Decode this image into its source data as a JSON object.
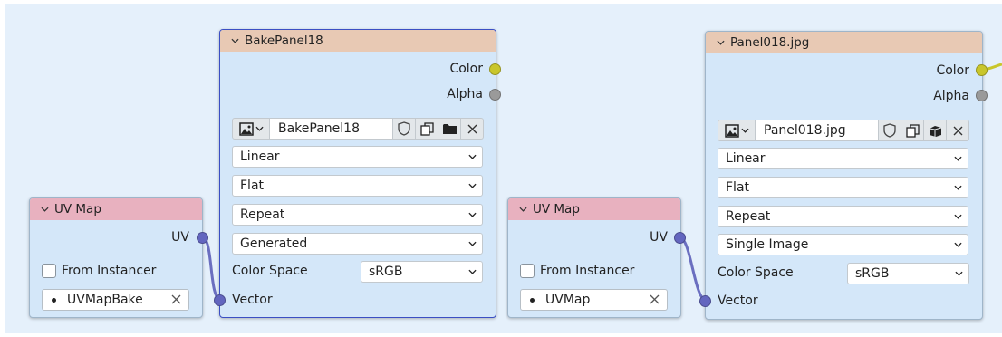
{
  "nodes": {
    "uvmap_left": {
      "title": "UV Map",
      "output": "UV",
      "from_instancer": "From Instancer",
      "uv_value": "UVMapBake"
    },
    "image_left": {
      "title": "BakePanel18",
      "outputs": [
        "Color",
        "Alpha"
      ],
      "image_name": "BakePanel18",
      "interpolation": "Linear",
      "projection": "Flat",
      "extension": "Repeat",
      "source": "Generated",
      "color_space_label": "Color Space",
      "color_space": "sRGB",
      "input": "Vector"
    },
    "uvmap_right": {
      "title": "UV Map",
      "output": "UV",
      "from_instancer": "From Instancer",
      "uv_value": "UVMap"
    },
    "image_right": {
      "title": "Panel018.jpg",
      "outputs": [
        "Color",
        "Alpha"
      ],
      "image_name": "Panel018.jpg",
      "interpolation": "Linear",
      "projection": "Flat",
      "extension": "Repeat",
      "source": "Single Image",
      "color_space_label": "Color Space",
      "color_space": "sRGB",
      "input": "Vector"
    }
  },
  "icons": {
    "collapse": "chevron-down-icon",
    "image_browse": "image-icon",
    "fake_user": "shield-icon",
    "duplicate": "copy-icon",
    "open_folder": "folder-icon",
    "pack": "pack-icon",
    "unlink": "close-icon"
  },
  "colors": {
    "editor_bg": "#e5f0fb",
    "node_bg": "#d4e7f9",
    "texture_header": "#e8c9b4",
    "uvmap_header": "#e8b1bf",
    "color_socket": "#c9c62b",
    "float_socket": "#9a9a9a",
    "vector_socket": "#6366bf",
    "selected_border": "#3b4fc4"
  }
}
